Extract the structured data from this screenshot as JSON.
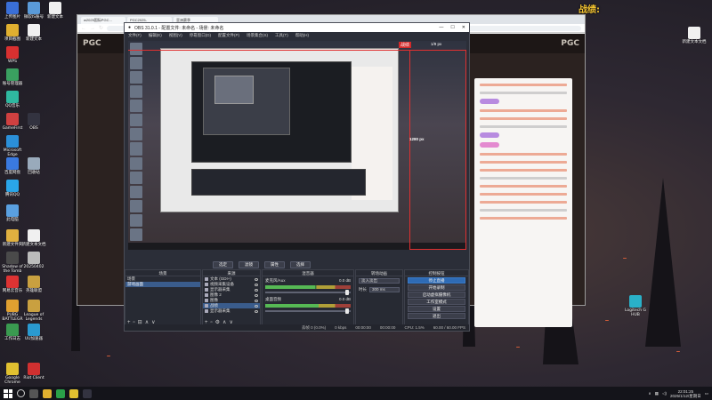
{
  "overlay_text": "战绩:",
  "desktop_icons": [
    {
      "label": "上传图片",
      "color": "#3a6fd8"
    },
    {
      "label": "微软IS账号",
      "color": "#5a9ad8"
    },
    {
      "label": "新建文本",
      "color": "#f0f0f0"
    },
    {
      "label": "新建文本",
      "color": "#f0f0f0"
    },
    {
      "label": "项目截图",
      "color": "#e0b030"
    },
    {
      "label": "工作日志",
      "color": "#c73a3a"
    },
    {
      "label": "WPS",
      "color": "#d83030"
    },
    {
      "label": "账号管理器",
      "color": "#3aa060"
    },
    {
      "label": "QQ音乐",
      "color": "#2fb8a0"
    },
    {
      "label": "GameFirst",
      "color": "#d04040"
    },
    {
      "label": "Microsoft Edge",
      "color": "#2b8fd8"
    },
    {
      "label": "百度网盘",
      "color": "#3a7ae0"
    },
    {
      "label": "腾讯QQ",
      "color": "#2aa5e8"
    },
    {
      "label": "此电脑",
      "color": "#5aa0e0"
    },
    {
      "label": "OBS",
      "color": "#333340"
    },
    {
      "label": "回收站",
      "color": "#9ab"
    },
    {
      "label": "Shadow of the Tomb",
      "color": "#4a4a4a"
    },
    {
      "label": "20250402",
      "color": "#bbb"
    },
    {
      "label": "英雄联盟",
      "color": "#c9a040"
    },
    {
      "label": "Riot Client",
      "color": "#d03030"
    },
    {
      "label": "网易云音乐",
      "color": "#d33"
    },
    {
      "label": "UU加速器",
      "color": "#2a9ad0"
    },
    {
      "label": "PUBG BATTLEGR",
      "color": "#e0a030"
    },
    {
      "label": "League of Legends",
      "color": "#c9a040"
    },
    {
      "label": "Google Chrome",
      "color": "#e0c030"
    },
    {
      "label": "Riot Client",
      "color": "#d03030"
    },
    {
      "label": "新建文件夹",
      "color": "#e0b040"
    },
    {
      "label": "新建文本文档",
      "color": "#f0f0f0"
    }
  ],
  "browser": {
    "tabs": [
      "w2025国际PGC...",
      "PGC2025-",
      "亚洲赛季"
    ],
    "brand": "PGC",
    "brand2": "PGC"
  },
  "obs": {
    "title": "OBS 31.0.1 - 配置文件: 未命名 - 场景: 未命名",
    "menu": [
      "文件(F)",
      "编辑(E)",
      "视图(V)",
      "停靠窗口(D)",
      "配置文件(P)",
      "场景集合(S)",
      "工具(T)",
      "帮助(H)"
    ],
    "preview": {
      "source_label": "战绩",
      "resolution": "1280 px",
      "resolution_top": "1/9 px"
    },
    "tab_buttons": [
      "选定",
      "滤镜",
      "属性",
      "选择"
    ],
    "scenes": {
      "header": "场景",
      "items": [
        "场景",
        "游戏画面"
      ]
    },
    "sources": {
      "header": "来源",
      "items": [
        "文本 (GDI+)",
        "视频采集设备",
        "显示器采集",
        "图像 2",
        "图像",
        "战绩",
        "显示器采集"
      ]
    },
    "mixer": {
      "header": "混音器",
      "channels": [
        {
          "name": "麦克风/Aux",
          "db": "0.0 dB",
          "level": 0.58,
          "volume": 0.98
        },
        {
          "name": "桌面音频",
          "db": "0.0 dB",
          "level": 0.62,
          "volume": 0.98
        }
      ]
    },
    "transitions": {
      "header": "转场动画",
      "type": "淡入淡出",
      "duration_label": "时长",
      "duration": "300 ms"
    },
    "controls": {
      "header": "控制按钮",
      "buttons": [
        "停止直播",
        "开始录制",
        "启动虚拟摄像机",
        "工作室模式",
        "设置",
        "退出"
      ]
    },
    "status": {
      "dropped": "丢帧 0 (0.0%)",
      "bitrate": "0 kbps",
      "rec_time": "00:00:00",
      "live_time": "00:00:00",
      "cpu": "CPU: 1.5%",
      "fps": "60.00 / 60.00 FPS"
    }
  },
  "right_icons": [
    {
      "label": "Logitech G HUB",
      "color": "#2ab0c8"
    }
  ],
  "taskbar": {
    "time": "22:01:25",
    "date": "2025/1/12/星期日"
  }
}
